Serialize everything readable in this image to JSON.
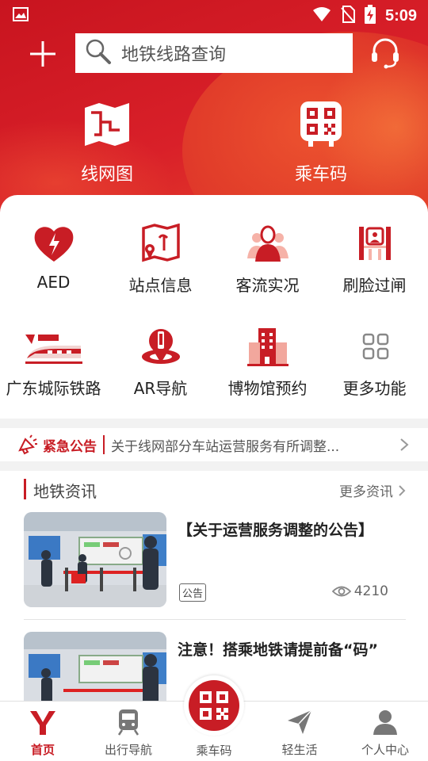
{
  "status_bar": {
    "time": "5:09"
  },
  "search": {
    "placeholder": "地铁线路查询"
  },
  "quick_tiles": [
    {
      "label": "线网图",
      "icon": "route-map-icon"
    },
    {
      "label": "乘车码",
      "icon": "ride-qr-code-icon"
    }
  ],
  "functions": [
    {
      "label": "AED",
      "icon": "aed-heart-icon"
    },
    {
      "label": "站点信息",
      "icon": "station-info-icon"
    },
    {
      "label": "客流实况",
      "icon": "passenger-flow-icon"
    },
    {
      "label": "刷脸过闸",
      "icon": "face-gate-icon"
    },
    {
      "label": "广东城际铁路",
      "icon": "intercity-train-icon"
    },
    {
      "label": "AR导航",
      "icon": "ar-navigation-icon"
    },
    {
      "label": "博物馆预约",
      "icon": "museum-icon"
    },
    {
      "label": "更多功能",
      "icon": "more-grid-icon"
    }
  ],
  "notice": {
    "tag": "紧急公告",
    "text": "关于线网部分车站运营服务有所调整..."
  },
  "news": {
    "section_title": "地铁资讯",
    "more_label": "更多资讯",
    "items": [
      {
        "title": "【关于运营服务调整的公告】",
        "badge": "公告",
        "views": "4210"
      },
      {
        "title": "注意！搭乘地铁请提前备“码”"
      }
    ]
  },
  "tabbar": [
    {
      "label": "首页",
      "icon": "home-logo-icon",
      "active": true
    },
    {
      "label": "出行导航",
      "icon": "train-icon"
    },
    {
      "label": "乘车码",
      "icon": "qr-code-icon"
    },
    {
      "label": "轻生活",
      "icon": "paper-plane-icon"
    },
    {
      "label": "个人中心",
      "icon": "person-icon"
    }
  ],
  "colors": {
    "brand_red": "#c81d25",
    "header_red": "#d92029"
  }
}
